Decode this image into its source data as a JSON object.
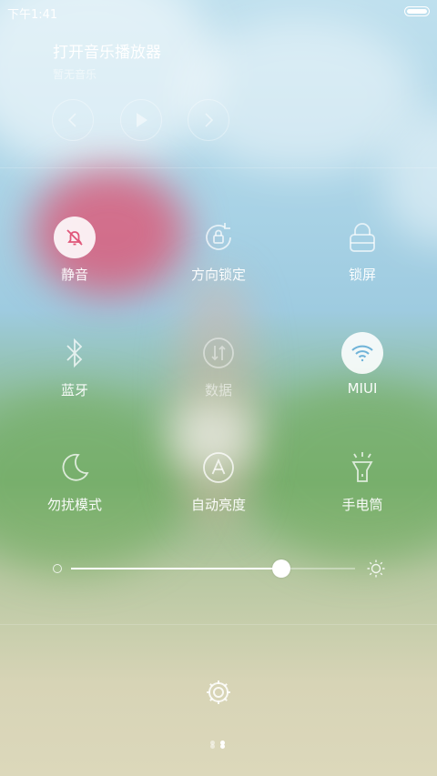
{
  "status_bar": {
    "time": "下午1:41"
  },
  "music": {
    "title": "打开音乐播放器",
    "subtitle": "暂无音乐",
    "prev_icon": "chevron-left-icon",
    "play_icon": "play-icon",
    "next_icon": "chevron-right-icon"
  },
  "toggles": [
    {
      "label": "静音",
      "icon": "bell-off-icon",
      "active": true
    },
    {
      "label": "方向锁定",
      "icon": "rotation-lock-icon",
      "active": false
    },
    {
      "label": "锁屏",
      "icon": "lock-icon",
      "active": false
    },
    {
      "label": "蓝牙",
      "icon": "bluetooth-icon",
      "active": false
    },
    {
      "label": "数据",
      "icon": "mobile-data-icon",
      "active": false,
      "dimmed": true
    },
    {
      "label": "MIUI",
      "icon": "wifi-icon",
      "active": true
    },
    {
      "label": "勿扰模式",
      "icon": "moon-icon",
      "active": false
    },
    {
      "label": "自动亮度",
      "icon": "auto-brightness-icon",
      "active": false
    },
    {
      "label": "手电筒",
      "icon": "flashlight-icon",
      "active": false
    }
  ],
  "brightness": {
    "level": 0.74,
    "min_icon": "brightness-low-icon",
    "max_icon": "brightness-high-icon"
  },
  "settings_icon": "gear-icon",
  "pager": {
    "pages": 2,
    "current": 2
  },
  "colors": {
    "accent_on": "#ffffff",
    "mute_icon_color": "#e0577a",
    "wifi_icon_color": "#6fb3d8"
  }
}
